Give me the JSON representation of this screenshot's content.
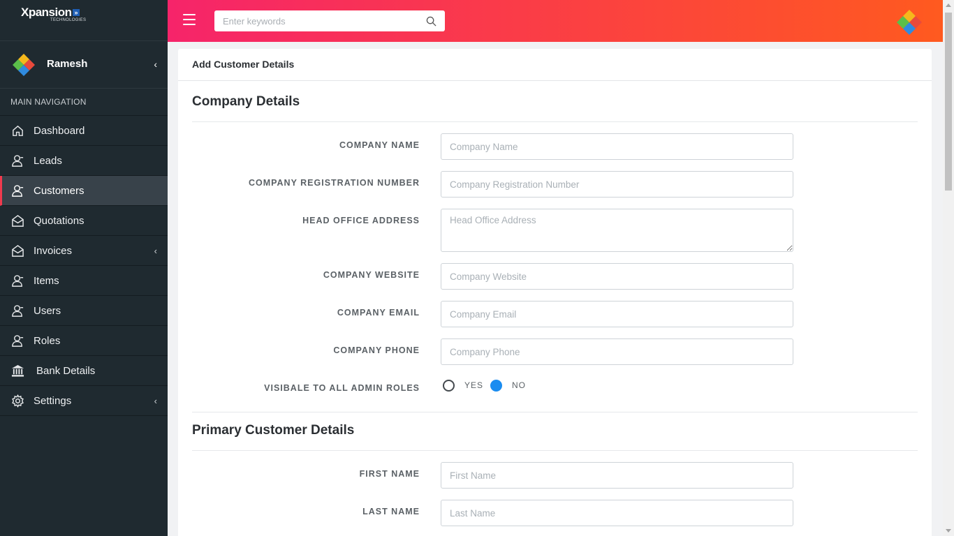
{
  "brand": {
    "name": "Xpansion",
    "badge": "»",
    "subtitle": "TECHNOLOGIES"
  },
  "user": {
    "name": "Ramesh"
  },
  "nav": {
    "title": "MAIN NAVIGATION",
    "items": [
      {
        "label": "Dashboard",
        "icon": "home-icon"
      },
      {
        "label": "Leads",
        "icon": "user-icon"
      },
      {
        "label": "Customers",
        "icon": "user-icon",
        "active": true
      },
      {
        "label": "Quotations",
        "icon": "envelope-icon"
      },
      {
        "label": "Invoices",
        "icon": "envelope-icon",
        "chevron": "‹"
      },
      {
        "label": "Items",
        "icon": "user-icon"
      },
      {
        "label": "Users",
        "icon": "user-icon"
      },
      {
        "label": "Roles",
        "icon": "user-icon"
      },
      {
        "label": "Bank Details",
        "icon": "bank-icon"
      },
      {
        "label": "Settings",
        "icon": "gear-icon",
        "chevron": "‹"
      }
    ]
  },
  "header": {
    "search_placeholder": "Enter keywords"
  },
  "page": {
    "title": "Add Customer Details",
    "company_section": "Company Details",
    "customer_section": "Primary Customer Details",
    "fields": {
      "company_name": {
        "label": "COMPANY NAME",
        "placeholder": "Company Name"
      },
      "reg_number": {
        "label": "COMPANY REGISTRATION NUMBER",
        "placeholder": "Company Registration Number"
      },
      "address": {
        "label": "HEAD OFFICE ADDRESS",
        "placeholder": "Head Office Address"
      },
      "website": {
        "label": "COMPANY WEBSITE",
        "placeholder": "Company Website"
      },
      "email": {
        "label": "COMPANY EMAIL",
        "placeholder": "Company Email"
      },
      "phone": {
        "label": "COMPANY PHONE",
        "placeholder": "Company Phone"
      },
      "visible": {
        "label": "VISIBALE TO ALL ADMIN ROLES",
        "yes": "YES",
        "no": "NO",
        "selected": "NO"
      },
      "first_name": {
        "label": "FIRST NAME",
        "placeholder": "First Name"
      },
      "last_name": {
        "label": "LAST NAME",
        "placeholder": "Last Name"
      }
    }
  },
  "colors": {
    "accent": "#f13a4e",
    "sidebar": "#1f2a30",
    "radio_checked": "#1a8cf0"
  }
}
